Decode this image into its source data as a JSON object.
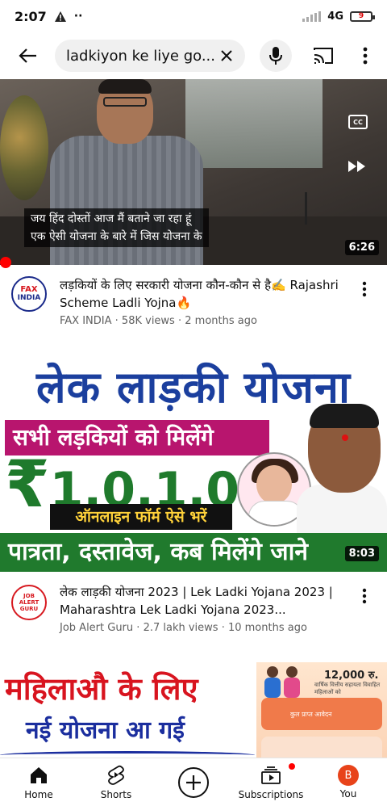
{
  "status_bar": {
    "time": "2:07",
    "network": "4G",
    "battery": "9"
  },
  "search": {
    "query": "ladkiyon ke liye go..."
  },
  "videos": [
    {
      "subtitle_line1": "जय हिंद दोस्तों आज मैं बताने जा रहा हूं",
      "subtitle_line2": "एक ऐसी योजना के बारे में जिस योजना के",
      "cc_label": "CC",
      "duration": "6:26",
      "title": "लड़कियों के लिए सरकारी योजना कौन-कौन से है✍️ Rajashri Scheme Ladli Yojna🔥",
      "channel": "FAX INDIA",
      "views": "58K views",
      "age": "2 months ago",
      "avatar_top": "FAX",
      "avatar_bottom": "INDIA"
    },
    {
      "thumb_title": "लेक लाड़की योजना",
      "thumb_pink": "सभी लड़कियों को मिलेंगे",
      "thumb_rupee": "₹",
      "thumb_amount": "1,0,1,000",
      "thumb_online": "ऑनलाइन फॉर्म ऐसे भरें",
      "thumb_green": "पात्रता, दस्तावेज, कब मिलेंगे जाने",
      "duration": "8:03",
      "title": "लेक लाड़की योजना 2023 | Lek Ladki Yojana 2023 | Maharashtra Lek Ladki Yojana 2023...",
      "channel": "Job Alert Guru",
      "views": "2.7 lakh views",
      "age": "10 months ago",
      "avatar_line1": "JOB",
      "avatar_line2": "ALERT",
      "avatar_line3": "GURU"
    },
    {
      "thumb_line1": "महिलाऔ के लिए",
      "thumb_line2": "नई योजना आ गई",
      "thumb_amount": "12,000 रु.",
      "thumb_sub": "वार्षिक वित्तीय सहायता विवाहित महिलाओं को",
      "thumb_card": "कुल प्राप्त आवेदन"
    }
  ],
  "bottom_nav": {
    "home": "Home",
    "shorts": "Shorts",
    "subscriptions": "Subscriptions",
    "you": "You",
    "you_initial": "B"
  },
  "colors": {
    "accent_red": "#ff0000",
    "avatar_orange": "#e8431a"
  }
}
